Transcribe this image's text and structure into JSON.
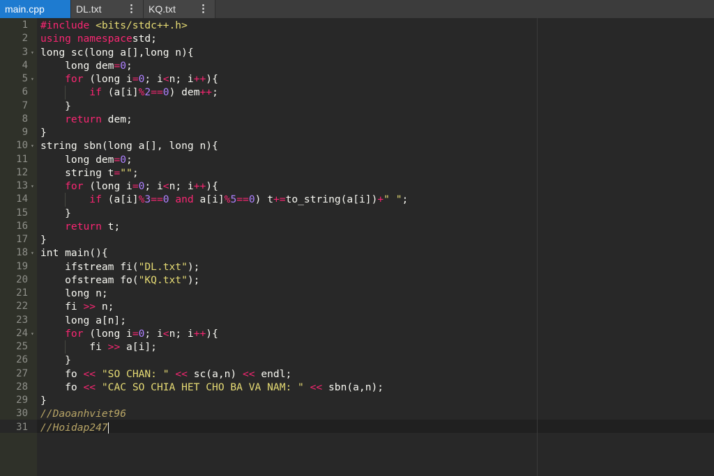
{
  "tabs": [
    {
      "label": "main.cpp",
      "active": true
    },
    {
      "label": "DL.txt",
      "active": false
    },
    {
      "label": "KQ.txt",
      "active": false
    }
  ],
  "theme": {
    "background": "#282828",
    "gutter": "#2f3129",
    "active_tab": "#1e7bd0",
    "keyword": "#f92672",
    "string": "#e6db74",
    "number": "#ae81ff",
    "comment": "#b8a566"
  },
  "icons": {
    "fold_arrow": "fold-arrow-icon",
    "tab_menu": "kebab-menu-icon"
  },
  "editor": {
    "active_line": 31,
    "lines": [
      {
        "n": "1",
        "fold": false,
        "tokens": [
          [
            "pp",
            "#include "
          ],
          [
            "inc",
            "<bits/stdc++.h>"
          ]
        ]
      },
      {
        "n": "2",
        "fold": false,
        "tokens": [
          [
            "kw",
            "using namespace"
          ],
          [
            "",
            "std;"
          ]
        ]
      },
      {
        "n": "3",
        "fold": true,
        "tokens": [
          [
            "",
            "long sc(long a[],long n){"
          ]
        ]
      },
      {
        "n": "4",
        "fold": false,
        "tokens": [
          [
            "",
            "    long dem"
          ],
          [
            "kw",
            "="
          ],
          [
            "nm",
            "0"
          ],
          [
            "",
            ";"
          ]
        ]
      },
      {
        "n": "5",
        "fold": true,
        "tokens": [
          [
            "kw",
            "    for"
          ],
          [
            "",
            " (long i"
          ],
          [
            "kw",
            "="
          ],
          [
            "nm",
            "0"
          ],
          [
            "",
            "; i"
          ],
          [
            "kw",
            "<"
          ],
          [
            "",
            "n; i"
          ],
          [
            "kw",
            "++"
          ],
          [
            "",
            "){"
          ]
        ]
      },
      {
        "n": "6",
        "fold": false,
        "tokens": [
          [
            "kw",
            "        if"
          ],
          [
            "",
            " (a[i]"
          ],
          [
            "kw",
            "%"
          ],
          [
            "nm",
            "2"
          ],
          [
            "kw",
            "=="
          ],
          [
            "nm",
            "0"
          ],
          [
            "",
            ") dem"
          ],
          [
            "kw",
            "++"
          ],
          [
            "",
            ";"
          ]
        ]
      },
      {
        "n": "7",
        "fold": false,
        "tokens": [
          [
            "",
            "    }"
          ]
        ]
      },
      {
        "n": "8",
        "fold": false,
        "tokens": [
          [
            "kw",
            "    return"
          ],
          [
            "",
            " dem;"
          ]
        ]
      },
      {
        "n": "9",
        "fold": false,
        "tokens": [
          [
            "",
            "}"
          ]
        ]
      },
      {
        "n": "10",
        "fold": true,
        "tokens": [
          [
            "",
            "string sbn(long a[], long n){"
          ]
        ]
      },
      {
        "n": "11",
        "fold": false,
        "tokens": [
          [
            "",
            "    long dem"
          ],
          [
            "kw",
            "="
          ],
          [
            "nm",
            "0"
          ],
          [
            "",
            ";"
          ]
        ]
      },
      {
        "n": "12",
        "fold": false,
        "tokens": [
          [
            "",
            "    string t"
          ],
          [
            "kw",
            "="
          ],
          [
            "st",
            "\"\""
          ],
          [
            "",
            ";"
          ]
        ]
      },
      {
        "n": "13",
        "fold": true,
        "tokens": [
          [
            "kw",
            "    for"
          ],
          [
            "",
            " (long i"
          ],
          [
            "kw",
            "="
          ],
          [
            "nm",
            "0"
          ],
          [
            "",
            "; i"
          ],
          [
            "kw",
            "<"
          ],
          [
            "",
            "n; i"
          ],
          [
            "kw",
            "++"
          ],
          [
            "",
            "){"
          ]
        ]
      },
      {
        "n": "14",
        "fold": false,
        "tokens": [
          [
            "kw",
            "        if"
          ],
          [
            "",
            " (a[i]"
          ],
          [
            "kw",
            "%"
          ],
          [
            "nm",
            "3"
          ],
          [
            "kw",
            "=="
          ],
          [
            "nm",
            "0"
          ],
          [
            "",
            " "
          ],
          [
            "kw",
            "and"
          ],
          [
            "",
            " a[i]"
          ],
          [
            "kw",
            "%"
          ],
          [
            "nm",
            "5"
          ],
          [
            "kw",
            "=="
          ],
          [
            "nm",
            "0"
          ],
          [
            "",
            ") t"
          ],
          [
            "kw",
            "+="
          ],
          [
            "",
            "to_string(a[i])"
          ],
          [
            "kw",
            "+"
          ],
          [
            "st",
            "\" \""
          ],
          [
            "",
            ";"
          ]
        ]
      },
      {
        "n": "15",
        "fold": false,
        "tokens": [
          [
            "",
            "    }"
          ]
        ]
      },
      {
        "n": "16",
        "fold": false,
        "tokens": [
          [
            "kw",
            "    return"
          ],
          [
            "",
            " t;"
          ]
        ]
      },
      {
        "n": "17",
        "fold": false,
        "tokens": [
          [
            "",
            "}"
          ]
        ]
      },
      {
        "n": "18",
        "fold": true,
        "tokens": [
          [
            "",
            "int main(){"
          ]
        ]
      },
      {
        "n": "19",
        "fold": false,
        "tokens": [
          [
            "",
            "    ifstream fi("
          ],
          [
            "st",
            "\"DL.txt\""
          ],
          [
            "",
            ");"
          ]
        ]
      },
      {
        "n": "20",
        "fold": false,
        "tokens": [
          [
            "",
            "    ofstream fo("
          ],
          [
            "st",
            "\"KQ.txt\""
          ],
          [
            "",
            ");"
          ]
        ]
      },
      {
        "n": "21",
        "fold": false,
        "tokens": [
          [
            "",
            "    long n;"
          ]
        ]
      },
      {
        "n": "22",
        "fold": false,
        "tokens": [
          [
            "",
            "    fi "
          ],
          [
            "kw",
            ">>"
          ],
          [
            "",
            " n;"
          ]
        ]
      },
      {
        "n": "23",
        "fold": false,
        "tokens": [
          [
            "",
            "    long a[n];"
          ]
        ]
      },
      {
        "n": "24",
        "fold": true,
        "tokens": [
          [
            "kw",
            "    for"
          ],
          [
            "",
            " (long i"
          ],
          [
            "kw",
            "="
          ],
          [
            "nm",
            "0"
          ],
          [
            "",
            "; i"
          ],
          [
            "kw",
            "<"
          ],
          [
            "",
            "n; i"
          ],
          [
            "kw",
            "++"
          ],
          [
            "",
            "){"
          ]
        ]
      },
      {
        "n": "25",
        "fold": false,
        "tokens": [
          [
            "",
            "        fi "
          ],
          [
            "kw",
            ">>"
          ],
          [
            "",
            " a[i];"
          ]
        ]
      },
      {
        "n": "26",
        "fold": false,
        "tokens": [
          [
            "",
            "    }"
          ]
        ]
      },
      {
        "n": "27",
        "fold": false,
        "tokens": [
          [
            "",
            "    fo "
          ],
          [
            "kw",
            "<<"
          ],
          [
            "",
            " "
          ],
          [
            "st",
            "\"SO CHAN: \""
          ],
          [
            "",
            " "
          ],
          [
            "kw",
            "<<"
          ],
          [
            "",
            " sc(a,n) "
          ],
          [
            "kw",
            "<<"
          ],
          [
            "",
            " endl;"
          ]
        ]
      },
      {
        "n": "28",
        "fold": false,
        "tokens": [
          [
            "",
            "    fo "
          ],
          [
            "kw",
            "<<"
          ],
          [
            "",
            " "
          ],
          [
            "st",
            "\"CAC SO CHIA HET CHO BA VA NAM: \""
          ],
          [
            "",
            " "
          ],
          [
            "kw",
            "<<"
          ],
          [
            "",
            " sbn(a,n);"
          ]
        ]
      },
      {
        "n": "29",
        "fold": false,
        "tokens": [
          [
            "",
            "}"
          ]
        ]
      },
      {
        "n": "30",
        "fold": false,
        "tokens": [
          [
            "cm",
            "//Daoanhviet96"
          ]
        ]
      },
      {
        "n": "31",
        "fold": false,
        "tokens": [
          [
            "cm",
            "//Hoidap247"
          ]
        ]
      }
    ]
  }
}
